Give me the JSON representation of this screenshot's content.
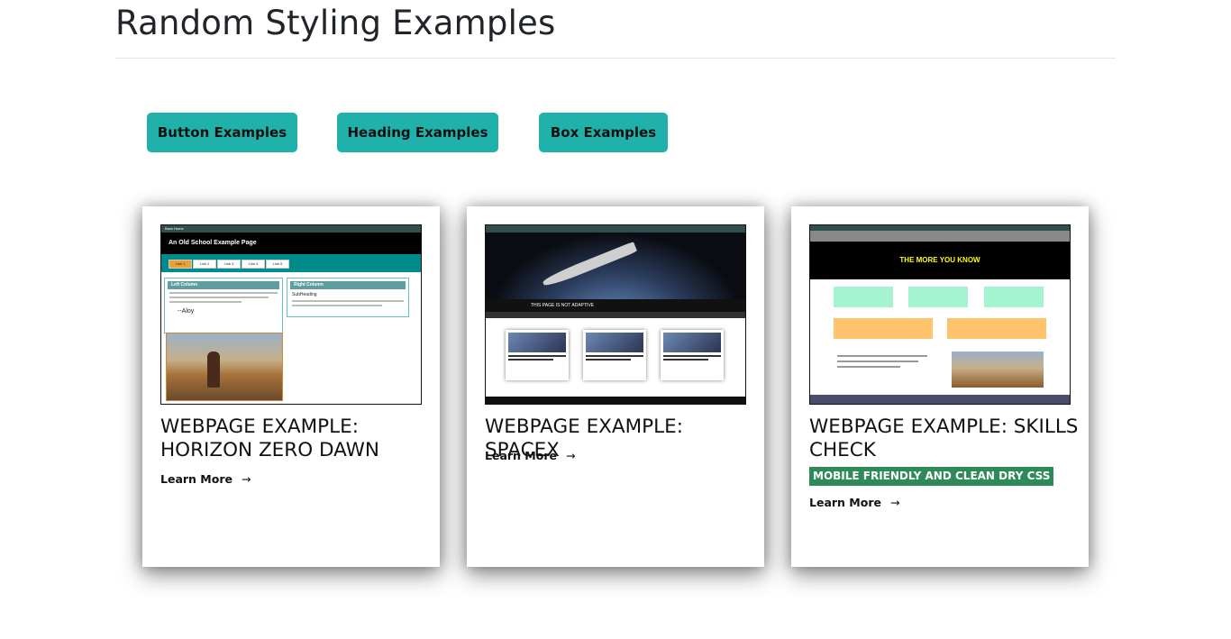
{
  "page": {
    "title": "Random Styling Examples"
  },
  "nav_buttons": [
    "Button Examples",
    "Heading Examples",
    "Box Examples"
  ],
  "cards": [
    {
      "title": "WEBPAGE EXAMPLE: HORIZON ZERO DAWN",
      "link": "Learn More",
      "thumb": {
        "bar_text": "Back Home",
        "header_text": "An Old School Example Page",
        "tabs": [
          "Link 1",
          "Link 2",
          "Link 3",
          "Link 4",
          "Link 5"
        ],
        "left_col": "Left Column",
        "right_col": "Right Column",
        "subheading": "SubHeading",
        "signature": "--Aloy"
      }
    },
    {
      "title": "WEBPAGE EXAMPLE: SPACEX",
      "link": "Learn More",
      "thumb": {
        "banner": "THIS PAGE IS NOT ADAPTIVE"
      }
    },
    {
      "title": "WEBPAGE EXAMPLE: SKILLS CHECK",
      "badge": "MOBILE FRIENDLY AND CLEAN DRY CSS",
      "link": "Learn More",
      "thumb": {
        "hero_text": "THE MORE YOU KNOW"
      }
    }
  ],
  "link_arrow": "→",
  "colors": {
    "button": "#20b2aa",
    "badge": "#2e8b57",
    "teal": "#008b8b"
  }
}
